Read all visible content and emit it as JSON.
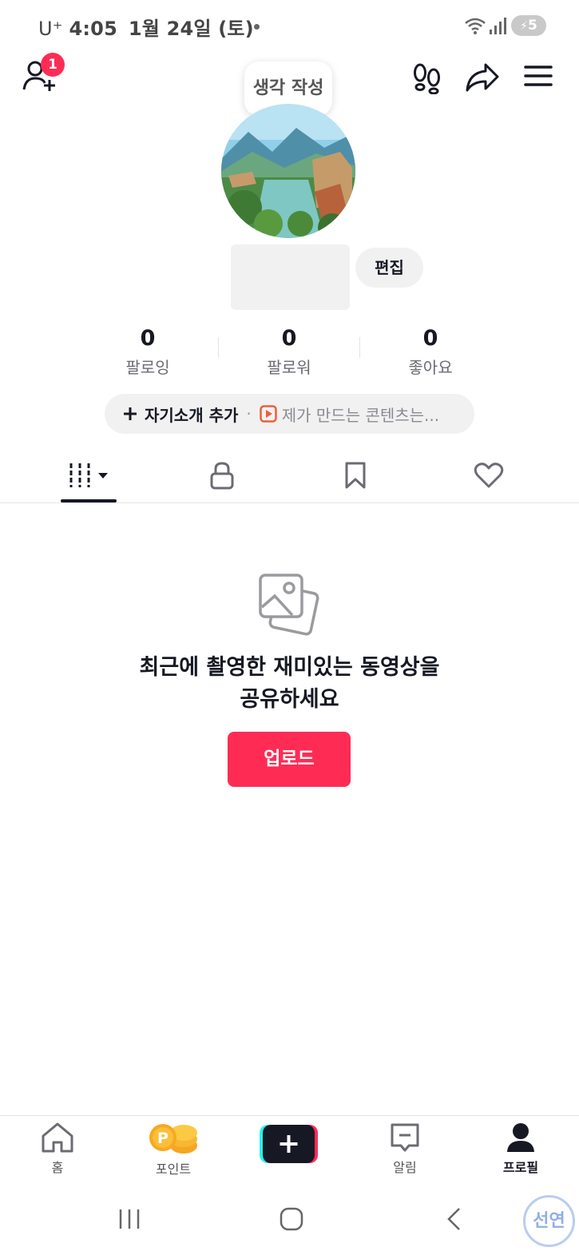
{
  "status_bar": {
    "carrier": "U⁺",
    "time": "4:05",
    "date": "1월 24일 (토)",
    "battery": "5"
  },
  "header": {
    "notification_count": "1",
    "tooltip": "생각 작성"
  },
  "profile": {
    "edit_label": "편집",
    "stats": [
      {
        "value": "0",
        "label": "팔로잉"
      },
      {
        "value": "0",
        "label": "팔로워"
      },
      {
        "value": "0",
        "label": "좋아요"
      }
    ],
    "bio_add_label": "자기소개 추가",
    "bio_separator": "·",
    "bio_promo": "제가 만드는 콘텐츠는..."
  },
  "tabs": [
    {
      "icon": "videos-grid-icon",
      "active": true
    },
    {
      "icon": "lock-icon",
      "active": false
    },
    {
      "icon": "bookmark-icon",
      "active": false
    },
    {
      "icon": "heart-icon",
      "active": false
    }
  ],
  "empty_state": {
    "title_line1": "최근에 촬영한 재미있는 동영상을",
    "title_line2": "공유하세요",
    "upload_label": "업로드"
  },
  "bottom_nav": [
    {
      "label": "홈",
      "icon": "home-icon"
    },
    {
      "label": "포인트",
      "icon": "points-coin-icon"
    },
    {
      "label": "",
      "icon": "create-plus-icon"
    },
    {
      "label": "알림",
      "icon": "inbox-icon"
    },
    {
      "label": "프로필",
      "icon": "profile-icon",
      "active": true
    }
  ],
  "watermark": "선연",
  "colors": {
    "accent": "#fe2c55",
    "text": "#161823",
    "muted": "#6b6b73",
    "pill_bg": "#f1f1f2"
  }
}
